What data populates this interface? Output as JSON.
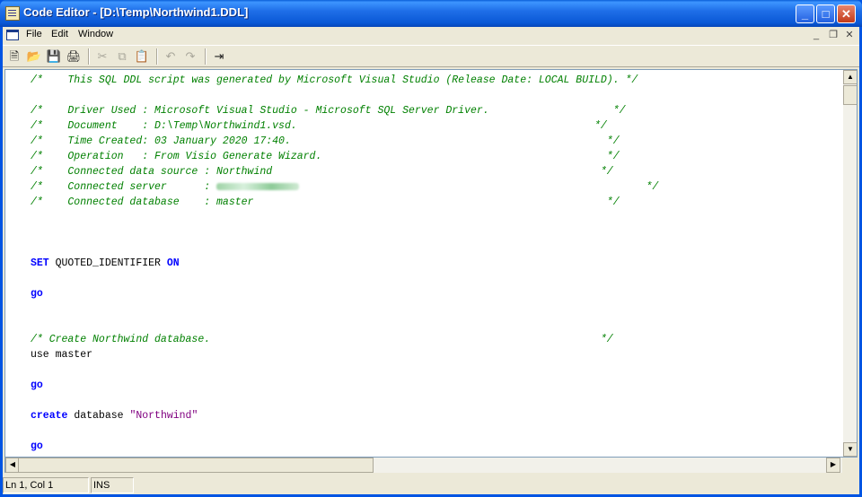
{
  "window": {
    "title": "Code Editor - [D:\\Temp\\Northwind1.DDL]",
    "controls": {
      "minimize": "_",
      "maximize": "□",
      "close": "✕"
    }
  },
  "menu": {
    "items": [
      "File",
      "Edit",
      "Window"
    ],
    "mdi_controls": {
      "minimize": "_",
      "restore": "❐",
      "close": "✕"
    }
  },
  "toolbar": {
    "icons": [
      "new-file-icon",
      "open-folder-icon",
      "save-icon",
      "print-icon",
      "cut-icon",
      "copy-icon",
      "paste-icon",
      "undo-icon",
      "redo-icon",
      "goto-icon"
    ]
  },
  "editor": {
    "lines": [
      [
        {
          "t": "/*    This SQL DDL script was generated by Microsoft Visual Studio (Release Date: LOCAL BUILD). */",
          "c": "cm"
        }
      ],
      [],
      [
        {
          "t": "/*    Driver Used : Microsoft Visual Studio - Microsoft SQL Server Driver.                    */",
          "c": "cm"
        }
      ],
      [
        {
          "t": "/*    Document    : D:\\Temp\\Northwind1.vsd.                                                */",
          "c": "cm"
        }
      ],
      [
        {
          "t": "/*    Time Created: 03 January 2020 17:40.                                                   */",
          "c": "cm"
        }
      ],
      [
        {
          "t": "/*    Operation   : From Visio Generate Wizard.                                              */",
          "c": "cm"
        }
      ],
      [
        {
          "t": "/*    Connected data source : Northwind                                                     */",
          "c": "cm"
        }
      ],
      [
        {
          "t": "/*    Connected server      : ",
          "c": "cm"
        },
        {
          "t": "",
          "c": "blur"
        },
        {
          "t": "                                                        */",
          "c": "cm"
        }
      ],
      [
        {
          "t": "/*    Connected database    : master                                                         */",
          "c": "cm"
        }
      ],
      [],
      [],
      [],
      [
        {
          "t": "SET",
          "c": "kw"
        },
        {
          "t": " QUOTED_IDENTIFIER ",
          "c": ""
        },
        {
          "t": "ON",
          "c": "kw"
        }
      ],
      [],
      [
        {
          "t": "go",
          "c": "kw"
        }
      ],
      [],
      [],
      [
        {
          "t": "/* Create Northwind database.                                                               */",
          "c": "cm"
        }
      ],
      [
        {
          "t": "use master",
          "c": ""
        }
      ],
      [],
      [
        {
          "t": "go",
          "c": "kw"
        }
      ],
      [],
      [
        {
          "t": "create",
          "c": "kw"
        },
        {
          "t": " database ",
          "c": ""
        },
        {
          "t": "\"Northwind\"",
          "c": "str"
        }
      ],
      [],
      [
        {
          "t": "go",
          "c": "kw"
        }
      ]
    ]
  },
  "status": {
    "position": "Ln 1, Col 1",
    "mode": "INS"
  }
}
